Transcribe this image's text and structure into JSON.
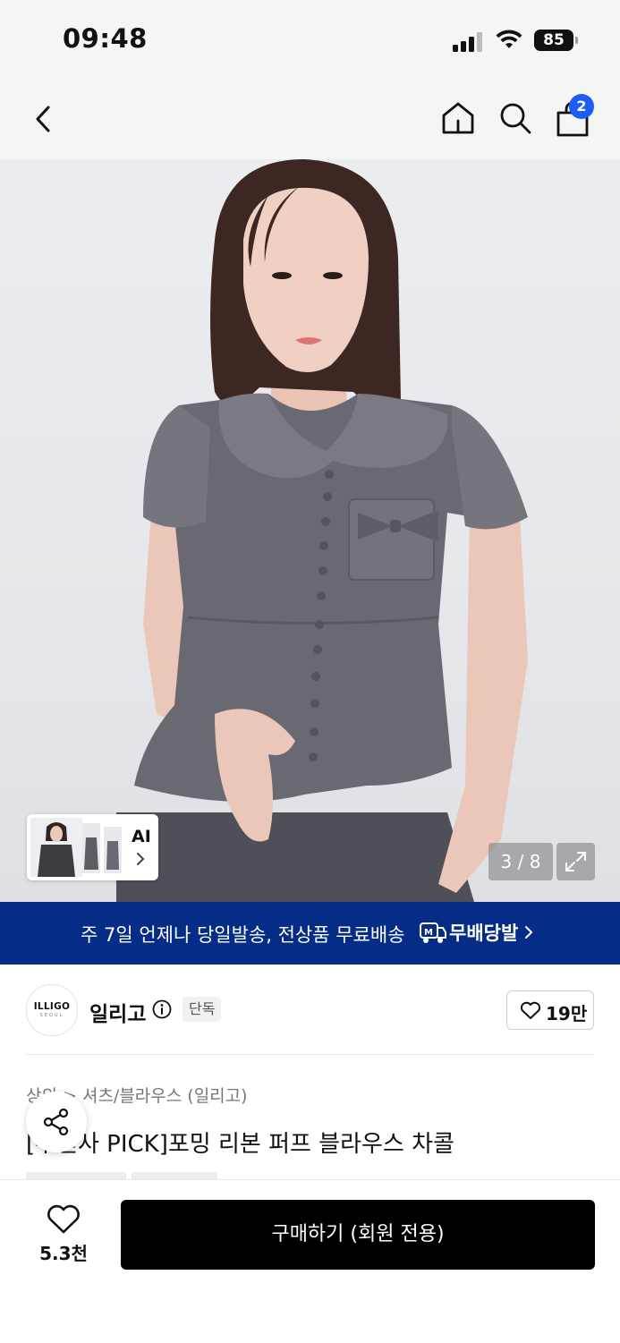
{
  "status_bar": {
    "time": "09:48",
    "battery": "85"
  },
  "nav": {
    "cart_count": "2"
  },
  "gallery": {
    "ai_label": "AI",
    "counter": "3 / 8"
  },
  "banner": {
    "text": "주 7일 언제나 당일발송, 전상품 무료배송",
    "badge": "무배당발"
  },
  "brand": {
    "logo_text": "ILLIGO",
    "logo_sub": "SEOUL",
    "name": "일리고",
    "exclusive": "단독",
    "likes": "19만"
  },
  "product": {
    "breadcrumb": "상의 > 셔츠/블라우스 (일리고)",
    "title": "[무신사 PICK]포밍 리본 퍼프 블라우스 차콜"
  },
  "bottom": {
    "wishlist_count": "5.3천",
    "buy_label": "구매하기 (회원 전용)"
  },
  "colors": {
    "banner_bg": "#052c86",
    "badge_blue": "#1d5cf5",
    "blouse": "#6a6870"
  },
  "icons": [
    "back-icon",
    "home-icon",
    "search-icon",
    "shopping-bag-icon",
    "expand-icon",
    "info-icon",
    "heart-icon",
    "share-icon",
    "truck-icon"
  ]
}
